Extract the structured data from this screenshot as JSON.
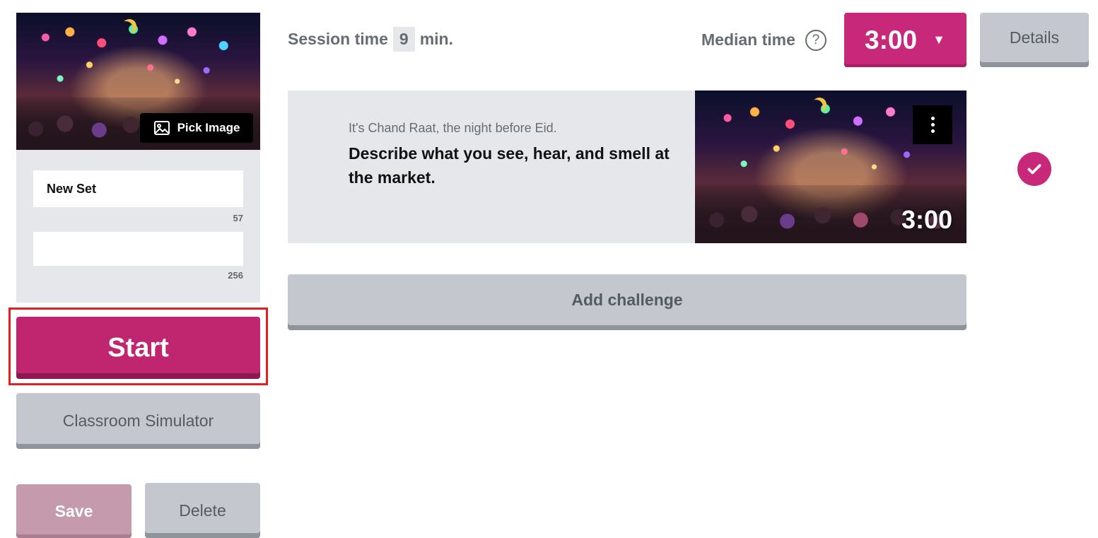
{
  "sidebar": {
    "pick_image_label": "Pick Image",
    "set_title": "New Set",
    "title_chars_remaining": "57",
    "description_value": "",
    "description_chars_remaining": "256",
    "start_label": "Start",
    "simulator_label": "Classroom Simulator",
    "save_label": "Save",
    "delete_label": "Delete"
  },
  "header": {
    "session_label": "Session time",
    "session_value": "9",
    "session_unit": "min.",
    "median_label": "Median time",
    "help_symbol": "?",
    "median_value": "3:00",
    "dropdown_caret": "▼",
    "details_label": "Details"
  },
  "challenge": {
    "intro": "It's Chand Raat, the night before Eid.",
    "prompt": "Describe what you see, hear, and smell at the market.",
    "time": "3:00",
    "selected": true
  },
  "add_challenge_label": "Add challenge",
  "colors": {
    "accent": "#c8287a",
    "accent_dark": "#8c1a51",
    "neutral_button": "#c4c7cd",
    "panel": "#e6e7ea",
    "highlight": "#e02020"
  },
  "icons": {
    "pick_image": "image-icon",
    "help": "question-circle-icon",
    "menu": "vertical-dots-icon",
    "selected": "check-icon",
    "dropdown": "caret-down-icon"
  }
}
